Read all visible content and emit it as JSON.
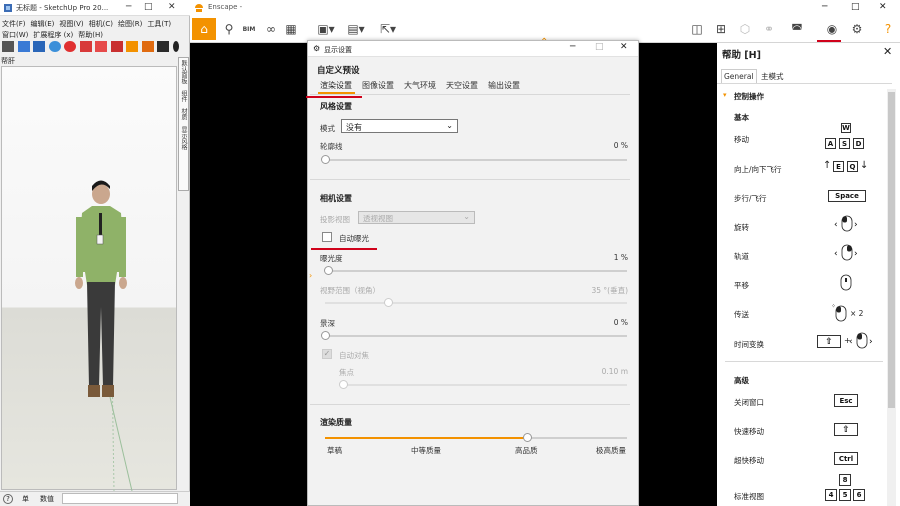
{
  "sketchup": {
    "title": "无标题 - SketchUp Pro 20...",
    "menu_row1": [
      "文件(F)",
      "编辑(E)",
      "视图(V)",
      "相机(C)",
      "绘图(R)",
      "工具(T)"
    ],
    "menu_row2": [
      "窗口(W)",
      "扩展程序 (x)",
      "帮助(H)"
    ],
    "scene_label": "帮肝",
    "side_tabs": [
      "默认面板",
      "组件",
      "材质",
      "显示风格"
    ],
    "status": {
      "help": "?",
      "unit": "单",
      "measure_label": "数值"
    }
  },
  "enscape": {
    "title": "Enscape -",
    "toolbar": {
      "bim": "BIM"
    }
  },
  "settings": {
    "window_title": "显示设置",
    "preset_heading": "自定义预设",
    "tabs": [
      "渲染设置",
      "图像设置",
      "大气环境",
      "天空设置",
      "输出设置"
    ],
    "style": {
      "heading": "风格设置",
      "mode_label": "模式",
      "mode_value": "没有",
      "outline_label": "轮廓线",
      "outline_value": "0 %",
      "outline_level": 0
    },
    "camera": {
      "heading": "相机设置",
      "projection_label": "投影视图",
      "projection_value": "透视视图",
      "auto_exposure_label": "自动曝光",
      "auto_exposure_checked": false,
      "exposure_label": "曝光度",
      "exposure_value": "1 %",
      "exposure_level": 0.01,
      "fov_label": "视野范围（视角）",
      "fov_value": "35 °(垂直)",
      "fov_level": 0.21,
      "dof_label": "景深",
      "dof_value": "0 %",
      "dof_level": 0,
      "autofocus_label": "自动对焦",
      "autofocus_checked": true,
      "focus_label": "焦点",
      "focus_value": "0.10  m",
      "focus_level": 0
    },
    "quality": {
      "heading": "渲染质量",
      "levels": [
        "草稿",
        "中等质量",
        "高品质",
        "极高质量"
      ],
      "level": 0.67
    }
  },
  "help": {
    "title": "帮助 [H]",
    "tabs": [
      "General",
      "主模式"
    ],
    "section": "控制操作",
    "basic_heading": "基本",
    "advanced_heading": "高级",
    "rows": [
      {
        "label": "移动",
        "keys": [
          "W",
          "A",
          "S",
          "D"
        ]
      },
      {
        "label": "向上/向下飞行",
        "keys": [
          "E",
          "Q"
        ]
      },
      {
        "label": "步行/飞行",
        "keys": [
          "Space"
        ]
      },
      {
        "label": "旋转",
        "icon": "mouse-left-drag-icon"
      },
      {
        "label": "轨道",
        "icon": "mouse-right-drag-icon"
      },
      {
        "label": "平移",
        "icon": "mouse-middle-drag-icon"
      },
      {
        "label": "传送",
        "icon": "mouse-double-click-icon",
        "suffix": "× 2"
      },
      {
        "label": "时间变换",
        "icon": "shift-plus-mouse-icon",
        "suffix": "+"
      }
    ],
    "advanced_rows": [
      {
        "label": "关闭窗口",
        "keys": [
          "Esc"
        ]
      },
      {
        "label": "快速移动",
        "keys": [
          "⇧"
        ]
      },
      {
        "label": "超快移动",
        "keys": [
          "Ctrl"
        ]
      },
      {
        "label": "标准视图",
        "keys": [
          "8",
          "4",
          "5",
          "6"
        ]
      }
    ]
  },
  "colors": {
    "accent": "#f39200",
    "highlight": "#d0021b"
  }
}
